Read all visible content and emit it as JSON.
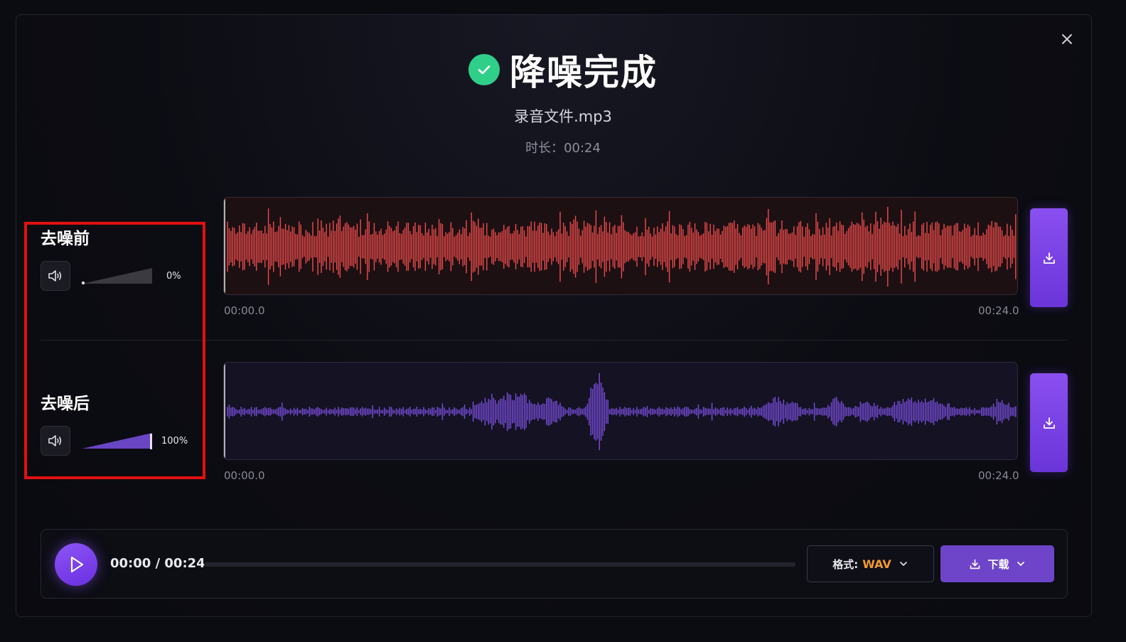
{
  "header": {
    "title": "降噪完成",
    "filename": "录音文件.mp3",
    "duration_label": "时长：",
    "duration_value": "00:24"
  },
  "tracks": [
    {
      "label": "去噪前",
      "volume_text": "0%",
      "volume": 0,
      "start_time": "00:00.0",
      "end_time": "00:24.0",
      "wave_color": "#ef4b4b"
    },
    {
      "label": "去噪后",
      "volume_text": "100%",
      "volume": 1,
      "start_time": "00:00.0",
      "end_time": "00:24.0",
      "wave_color": "#7b4fe0"
    }
  ],
  "player": {
    "time": "00:00 / 00:24",
    "progress": 0,
    "format_label": "格式:",
    "format_value": "WAV",
    "download_label": "下载"
  },
  "icons": {
    "close": "close-icon",
    "check": "check-circle-icon",
    "volume": "speaker-icon",
    "download": "download-icon",
    "play": "play-icon",
    "chevron": "chevron-down-icon"
  },
  "colors": {
    "accent": "#7b4fe0",
    "success": "#2fcf8a",
    "format_highlight": "#f29a2e",
    "annotation": "#e21010"
  }
}
